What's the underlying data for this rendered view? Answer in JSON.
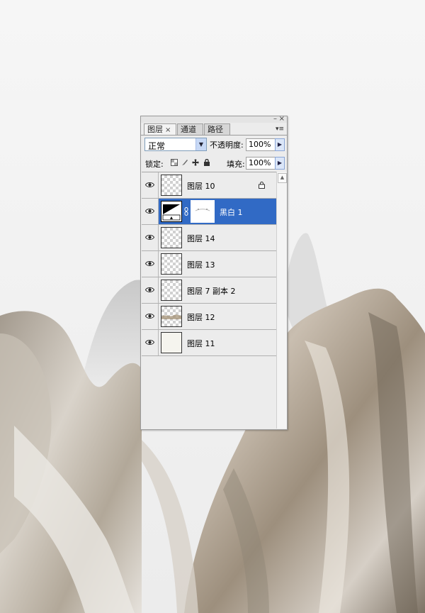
{
  "panel": {
    "tabs": [
      {
        "label": "图层",
        "close": "×"
      },
      {
        "label": "通道"
      },
      {
        "label": "路径"
      }
    ],
    "window_buttons": {
      "minimize": "–",
      "close": "×"
    },
    "menu_icon": "▾≡",
    "blend_mode": "正常",
    "opacity_label": "不透明度:",
    "opacity_value": "100%",
    "lock_label": "锁定:",
    "fill_label": "填充:",
    "fill_value": "100%",
    "layers": [
      {
        "name": "图层 10",
        "visible": true,
        "locked": true,
        "selected": false,
        "thumb": "transparent-light"
      },
      {
        "name": "黑白 1",
        "visible": true,
        "locked": false,
        "selected": true,
        "thumb": "adjustment-bw"
      },
      {
        "name": "图层 14",
        "visible": true,
        "locked": false,
        "selected": false,
        "thumb": "transparent"
      },
      {
        "name": "图层 13",
        "visible": true,
        "locked": false,
        "selected": false,
        "thumb": "transparent"
      },
      {
        "name": "图层 7 副本 2",
        "visible": true,
        "locked": false,
        "selected": false,
        "thumb": "transparent"
      },
      {
        "name": "图层 12",
        "visible": true,
        "locked": false,
        "selected": false,
        "thumb": "landscape-strip"
      },
      {
        "name": "图层 11",
        "visible": true,
        "locked": false,
        "selected": false,
        "thumb": "solid-white"
      }
    ]
  },
  "colors": {
    "selected_row": "#316ac5",
    "panel_bg": "#ececec"
  }
}
